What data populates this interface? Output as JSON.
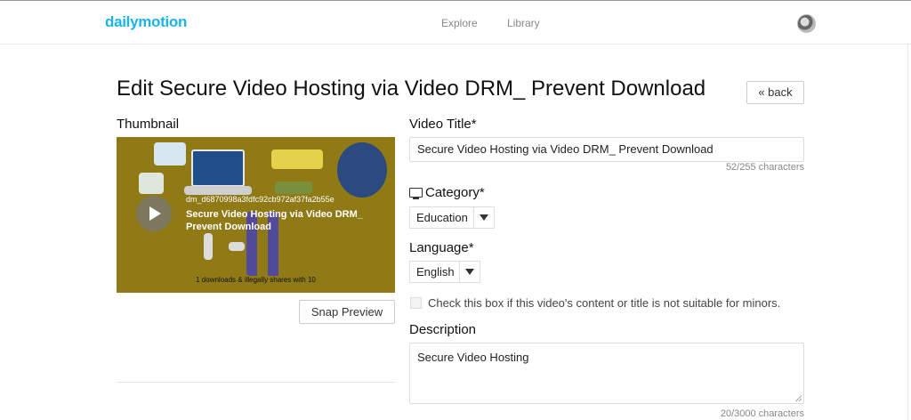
{
  "header": {
    "logo": "dailymotion",
    "nav": {
      "explore": "Explore",
      "library": "Library"
    }
  },
  "page": {
    "title": "Edit Secure Video Hosting via Video DRM_ Prevent Download",
    "back_label": "« back"
  },
  "thumbnail": {
    "label": "Thumbnail",
    "video_id": "dm_d6870998a3fdfc92cb972af37fa2b55e",
    "overlay_title": "Secure Video Hosting via Video DRM_ Prevent Download",
    "caption": "1 downloads & illegally shares with 10",
    "snap_label": "Snap Preview"
  },
  "form": {
    "video_title": {
      "label": "Video Title*",
      "value": "Secure Video Hosting via Video DRM_ Prevent Download",
      "counter": "52/255 characters"
    },
    "category": {
      "label": "Category*",
      "value": "Education"
    },
    "language": {
      "label": "Language*",
      "value": "English"
    },
    "minors": {
      "label": "Check this box if this video's content or title is not suitable for minors.",
      "checked": false
    },
    "description": {
      "label": "Description",
      "value": "Secure Video Hosting",
      "counter": "20/3000 characters"
    }
  },
  "icons": {
    "category": "monitor-icon",
    "play": "play-icon",
    "avatar": "user-avatar"
  },
  "colors": {
    "brand": "#1ab5e8",
    "thumb_bg": "#8f7a16"
  }
}
